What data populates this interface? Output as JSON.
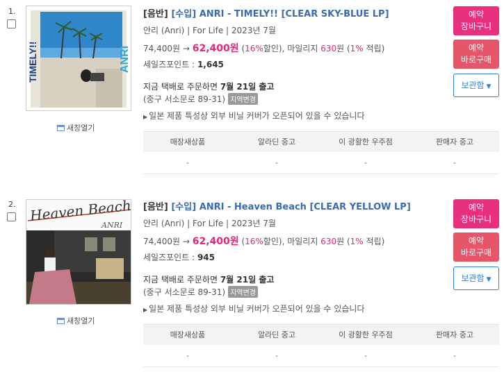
{
  "items": [
    {
      "number": "1.",
      "category": "[음반]",
      "import_tag": "[수입]",
      "title": "ANRI - TIMELY!! [CLEAR SKY-BLUE LP]",
      "artist": "안리 (Anri)",
      "label": "For Life",
      "date": "2023년 7월",
      "list_price": "74,400원",
      "sale_price": "62,400원",
      "discount_pct": "16%",
      "discount_label": "할인",
      "mileage_label": "마일리지",
      "mileage": "630",
      "mileage_pct": "1%",
      "mileage_suffix": "적립",
      "points_label": "세일즈포인트 :",
      "points": "1,645",
      "ship_prefix": "지금 택배로 주문하면",
      "ship_date": "7월 21일 출고",
      "address": "(중구 서소문로 89-31)",
      "region_btn": "지역변경",
      "notice": "일본 제품 특성상 외부 비닐 커버가 오픈되어 있을 수 있습니다",
      "new_window": "새창열기",
      "btn_cart": [
        "예약",
        "장바구니"
      ],
      "btn_buy": [
        "예약",
        "바로구매"
      ],
      "btn_keep": "보관함",
      "used_headers": [
        "매장새상품",
        "알라딘 중고",
        "이 광활한 우주점",
        "판매자 중고"
      ],
      "used_values": [
        "-",
        "-",
        "-",
        "-"
      ],
      "cover_text": [
        "TIMELY!!",
        "ANRI"
      ]
    },
    {
      "number": "2.",
      "category": "[음반]",
      "import_tag": "[수입]",
      "title": "ANRI - Heaven Beach [CLEAR YELLOW LP]",
      "artist": "안리 (Anri)",
      "label": "For Life",
      "date": "2023년 7월",
      "list_price": "74,400원",
      "sale_price": "62,400원",
      "discount_pct": "16%",
      "discount_label": "할인",
      "mileage_label": "마일리지",
      "mileage": "630",
      "mileage_pct": "1%",
      "mileage_suffix": "적립",
      "points_label": "세일즈포인트 :",
      "points": "945",
      "ship_prefix": "지금 택배로 주문하면",
      "ship_date": "7월 21일 출고",
      "address": "(중구 서소문로 89-31)",
      "region_btn": "지역변경",
      "notice": "일본 제품 특성상 외부 비닐 커버가 오픈되어 있을 수 있습니다",
      "new_window": "새창열기",
      "btn_cart": [
        "예약",
        "장바구니"
      ],
      "btn_buy": [
        "예약",
        "바로구매"
      ],
      "btn_keep": "보관함",
      "used_headers": [
        "매장새상품",
        "알라딘 중고",
        "이 광활한 우주점",
        "판매자 중고"
      ],
      "used_values": [
        "-",
        "-",
        "-",
        "-"
      ],
      "cover_text": [
        "Heaven Beach",
        "ANRI"
      ]
    }
  ]
}
